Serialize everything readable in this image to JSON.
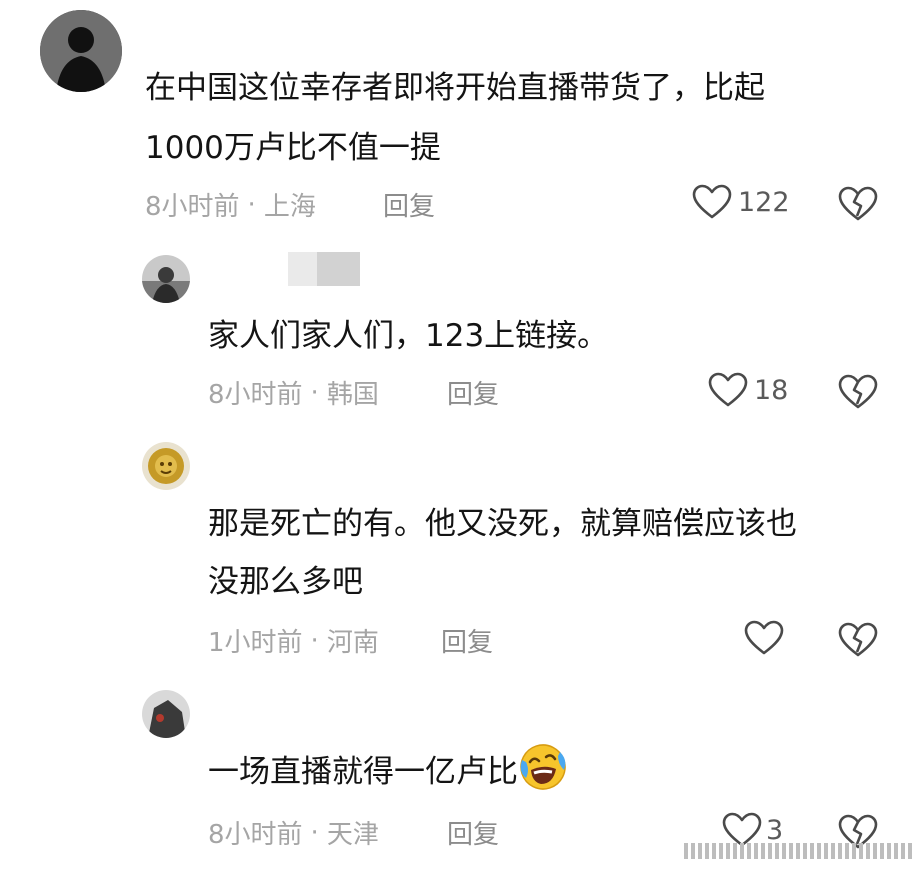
{
  "comments": [
    {
      "name": "",
      "text_lines": [
        "在中国这位幸存者即将开始直播带货了，比起",
        "1000万卢比不值一提"
      ],
      "time": "8小时前",
      "location": "上海",
      "reply_label": "回复",
      "likes": "122"
    },
    {
      "name": "",
      "text_lines": [
        "家人们家人们，123上链接。"
      ],
      "time": "8小时前",
      "location": "韩国",
      "reply_label": "回复",
      "likes": "18"
    },
    {
      "name": "",
      "text_lines": [
        "那是死亡的有。他又没死，就算赔偿应该也",
        "没那么多吧"
      ],
      "time": "1小时前",
      "location": "河南",
      "reply_label": "回复",
      "likes": ""
    },
    {
      "name": "",
      "text_lines": [
        "一场直播就得一亿卢比"
      ],
      "time": "8小时前",
      "location": "天津",
      "reply_label": "回复",
      "likes": "3"
    }
  ],
  "meta_separator": "·",
  "icons": {
    "like": "heart-outline-icon",
    "dislike": "broken-heart-icon",
    "emoji": "laughing-crying-emoji"
  },
  "colors": {
    "text": "#141414",
    "meta": "#a5a5a5",
    "icon": "#4a4a4a"
  }
}
